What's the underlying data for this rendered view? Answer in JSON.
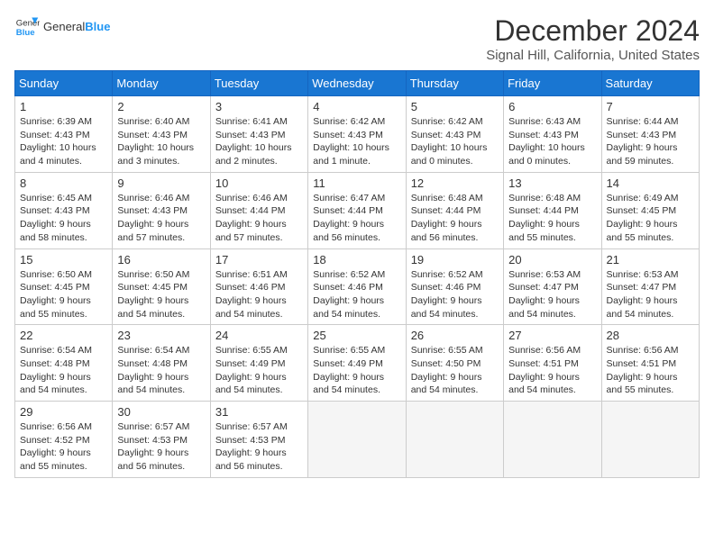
{
  "header": {
    "logo_general": "General",
    "logo_blue": "Blue",
    "title": "December 2024",
    "location": "Signal Hill, California, United States"
  },
  "weekdays": [
    "Sunday",
    "Monday",
    "Tuesday",
    "Wednesday",
    "Thursday",
    "Friday",
    "Saturday"
  ],
  "weeks": [
    [
      {
        "day": 1,
        "lines": [
          "Sunrise: 6:39 AM",
          "Sunset: 4:43 PM",
          "Daylight: 10 hours",
          "and 4 minutes."
        ]
      },
      {
        "day": 2,
        "lines": [
          "Sunrise: 6:40 AM",
          "Sunset: 4:43 PM",
          "Daylight: 10 hours",
          "and 3 minutes."
        ]
      },
      {
        "day": 3,
        "lines": [
          "Sunrise: 6:41 AM",
          "Sunset: 4:43 PM",
          "Daylight: 10 hours",
          "and 2 minutes."
        ]
      },
      {
        "day": 4,
        "lines": [
          "Sunrise: 6:42 AM",
          "Sunset: 4:43 PM",
          "Daylight: 10 hours",
          "and 1 minute."
        ]
      },
      {
        "day": 5,
        "lines": [
          "Sunrise: 6:42 AM",
          "Sunset: 4:43 PM",
          "Daylight: 10 hours",
          "and 0 minutes."
        ]
      },
      {
        "day": 6,
        "lines": [
          "Sunrise: 6:43 AM",
          "Sunset: 4:43 PM",
          "Daylight: 10 hours",
          "and 0 minutes."
        ]
      },
      {
        "day": 7,
        "lines": [
          "Sunrise: 6:44 AM",
          "Sunset: 4:43 PM",
          "Daylight: 9 hours",
          "and 59 minutes."
        ]
      }
    ],
    [
      {
        "day": 8,
        "lines": [
          "Sunrise: 6:45 AM",
          "Sunset: 4:43 PM",
          "Daylight: 9 hours",
          "and 58 minutes."
        ]
      },
      {
        "day": 9,
        "lines": [
          "Sunrise: 6:46 AM",
          "Sunset: 4:43 PM",
          "Daylight: 9 hours",
          "and 57 minutes."
        ]
      },
      {
        "day": 10,
        "lines": [
          "Sunrise: 6:46 AM",
          "Sunset: 4:44 PM",
          "Daylight: 9 hours",
          "and 57 minutes."
        ]
      },
      {
        "day": 11,
        "lines": [
          "Sunrise: 6:47 AM",
          "Sunset: 4:44 PM",
          "Daylight: 9 hours",
          "and 56 minutes."
        ]
      },
      {
        "day": 12,
        "lines": [
          "Sunrise: 6:48 AM",
          "Sunset: 4:44 PM",
          "Daylight: 9 hours",
          "and 56 minutes."
        ]
      },
      {
        "day": 13,
        "lines": [
          "Sunrise: 6:48 AM",
          "Sunset: 4:44 PM",
          "Daylight: 9 hours",
          "and 55 minutes."
        ]
      },
      {
        "day": 14,
        "lines": [
          "Sunrise: 6:49 AM",
          "Sunset: 4:45 PM",
          "Daylight: 9 hours",
          "and 55 minutes."
        ]
      }
    ],
    [
      {
        "day": 15,
        "lines": [
          "Sunrise: 6:50 AM",
          "Sunset: 4:45 PM",
          "Daylight: 9 hours",
          "and 55 minutes."
        ]
      },
      {
        "day": 16,
        "lines": [
          "Sunrise: 6:50 AM",
          "Sunset: 4:45 PM",
          "Daylight: 9 hours",
          "and 54 minutes."
        ]
      },
      {
        "day": 17,
        "lines": [
          "Sunrise: 6:51 AM",
          "Sunset: 4:46 PM",
          "Daylight: 9 hours",
          "and 54 minutes."
        ]
      },
      {
        "day": 18,
        "lines": [
          "Sunrise: 6:52 AM",
          "Sunset: 4:46 PM",
          "Daylight: 9 hours",
          "and 54 minutes."
        ]
      },
      {
        "day": 19,
        "lines": [
          "Sunrise: 6:52 AM",
          "Sunset: 4:46 PM",
          "Daylight: 9 hours",
          "and 54 minutes."
        ]
      },
      {
        "day": 20,
        "lines": [
          "Sunrise: 6:53 AM",
          "Sunset: 4:47 PM",
          "Daylight: 9 hours",
          "and 54 minutes."
        ]
      },
      {
        "day": 21,
        "lines": [
          "Sunrise: 6:53 AM",
          "Sunset: 4:47 PM",
          "Daylight: 9 hours",
          "and 54 minutes."
        ]
      }
    ],
    [
      {
        "day": 22,
        "lines": [
          "Sunrise: 6:54 AM",
          "Sunset: 4:48 PM",
          "Daylight: 9 hours",
          "and 54 minutes."
        ]
      },
      {
        "day": 23,
        "lines": [
          "Sunrise: 6:54 AM",
          "Sunset: 4:48 PM",
          "Daylight: 9 hours",
          "and 54 minutes."
        ]
      },
      {
        "day": 24,
        "lines": [
          "Sunrise: 6:55 AM",
          "Sunset: 4:49 PM",
          "Daylight: 9 hours",
          "and 54 minutes."
        ]
      },
      {
        "day": 25,
        "lines": [
          "Sunrise: 6:55 AM",
          "Sunset: 4:49 PM",
          "Daylight: 9 hours",
          "and 54 minutes."
        ]
      },
      {
        "day": 26,
        "lines": [
          "Sunrise: 6:55 AM",
          "Sunset: 4:50 PM",
          "Daylight: 9 hours",
          "and 54 minutes."
        ]
      },
      {
        "day": 27,
        "lines": [
          "Sunrise: 6:56 AM",
          "Sunset: 4:51 PM",
          "Daylight: 9 hours",
          "and 54 minutes."
        ]
      },
      {
        "day": 28,
        "lines": [
          "Sunrise: 6:56 AM",
          "Sunset: 4:51 PM",
          "Daylight: 9 hours",
          "and 55 minutes."
        ]
      }
    ],
    [
      {
        "day": 29,
        "lines": [
          "Sunrise: 6:56 AM",
          "Sunset: 4:52 PM",
          "Daylight: 9 hours",
          "and 55 minutes."
        ]
      },
      {
        "day": 30,
        "lines": [
          "Sunrise: 6:57 AM",
          "Sunset: 4:53 PM",
          "Daylight: 9 hours",
          "and 56 minutes."
        ]
      },
      {
        "day": 31,
        "lines": [
          "Sunrise: 6:57 AM",
          "Sunset: 4:53 PM",
          "Daylight: 9 hours",
          "and 56 minutes."
        ]
      },
      null,
      null,
      null,
      null
    ]
  ]
}
